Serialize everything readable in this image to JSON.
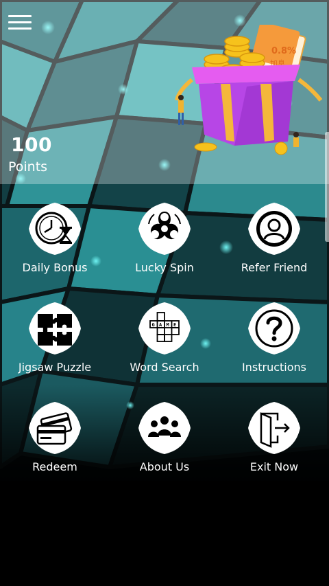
{
  "header": {
    "menu_icon": "hamburger-menu-icon",
    "points_value": "100",
    "points_label": "Points",
    "illustration": "gift-box-coins-illustration",
    "illustration_tag": "0.8%",
    "illustration_text": "加息"
  },
  "menu": {
    "items": [
      {
        "label": "Daily Bonus",
        "icon": "clock-hourglass-icon"
      },
      {
        "label": "Lucky Spin",
        "icon": "fidget-spinner-icon"
      },
      {
        "label": "Refer Friend",
        "icon": "user-avatar-icon"
      },
      {
        "label": "Jigsaw Puzzle",
        "icon": "puzzle-pieces-icon"
      },
      {
        "label": "Word Search",
        "icon": "crossword-game-icon"
      },
      {
        "label": "Instructions",
        "icon": "question-mark-icon"
      },
      {
        "label": "Redeem",
        "icon": "cards-wallet-icon"
      },
      {
        "label": "About Us",
        "icon": "team-people-icon"
      },
      {
        "label": "Exit Now",
        "icon": "exit-door-icon"
      }
    ]
  },
  "colors": {
    "accent_teal": "#2a8f93",
    "background": "#000000",
    "badge": "#ffffff"
  }
}
